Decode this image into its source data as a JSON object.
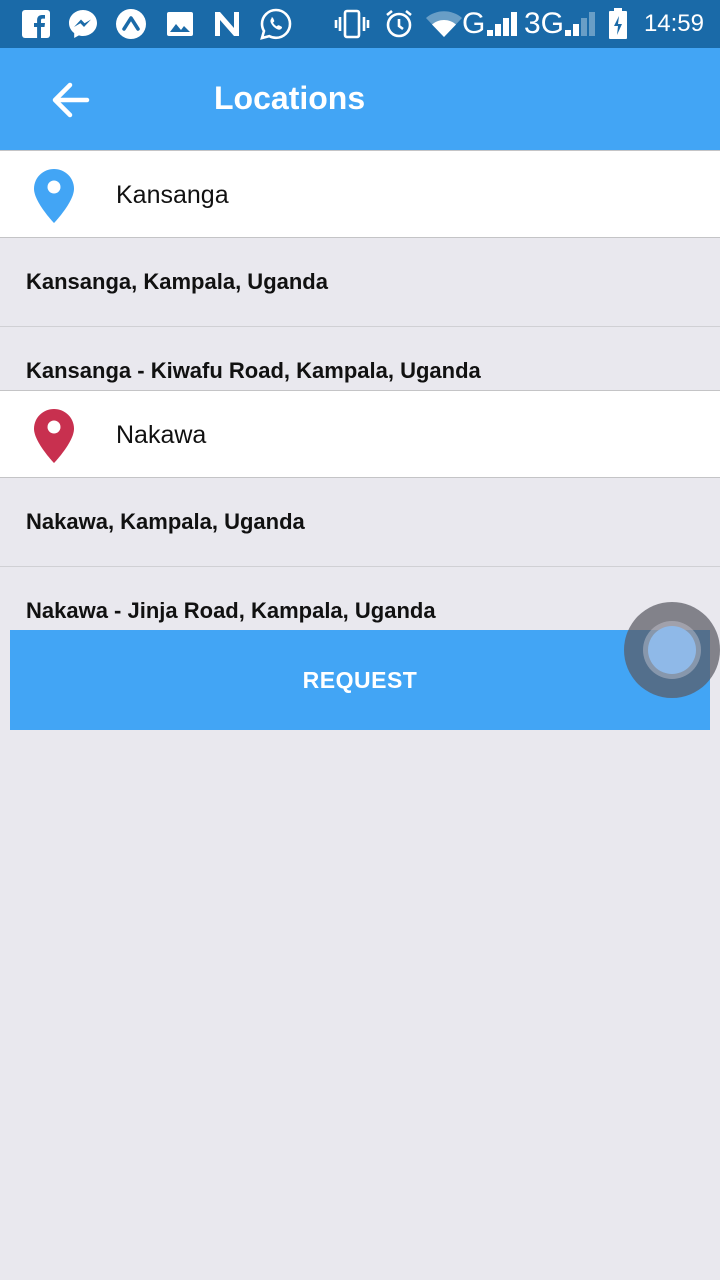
{
  "status_bar": {
    "time": "14:59",
    "network_labels": [
      "G",
      "3G"
    ],
    "icons": [
      "facebook-icon",
      "messenger-icon",
      "arrow-up-icon",
      "gallery-icon",
      "n-app-icon",
      "whatsapp-icon",
      "vibrate-icon",
      "alarm-icon",
      "wifi-icon",
      "signal-icon",
      "battery-charging-icon"
    ]
  },
  "app_bar": {
    "title": "Locations",
    "back_icon": "arrow-back-icon"
  },
  "pickup": {
    "value": "Kansanga",
    "pin_color": "#42a5f5",
    "suggestions": [
      "Kansanga, Kampala, Uganda",
      "Kansanga - Kiwafu Road, Kampala, Uganda"
    ]
  },
  "dropoff": {
    "value": "Nakawa",
    "pin_color": "#c8304f",
    "suggestions": [
      "Nakawa, Kampala, Uganda",
      "Nakawa - Jinja Road, Kampala, Uganda"
    ]
  },
  "request_button": {
    "label": "REQUEST"
  },
  "colors": {
    "primary": "#42a5f5",
    "status_bar": "#1a6aa8",
    "background": "#e9e8ee"
  }
}
